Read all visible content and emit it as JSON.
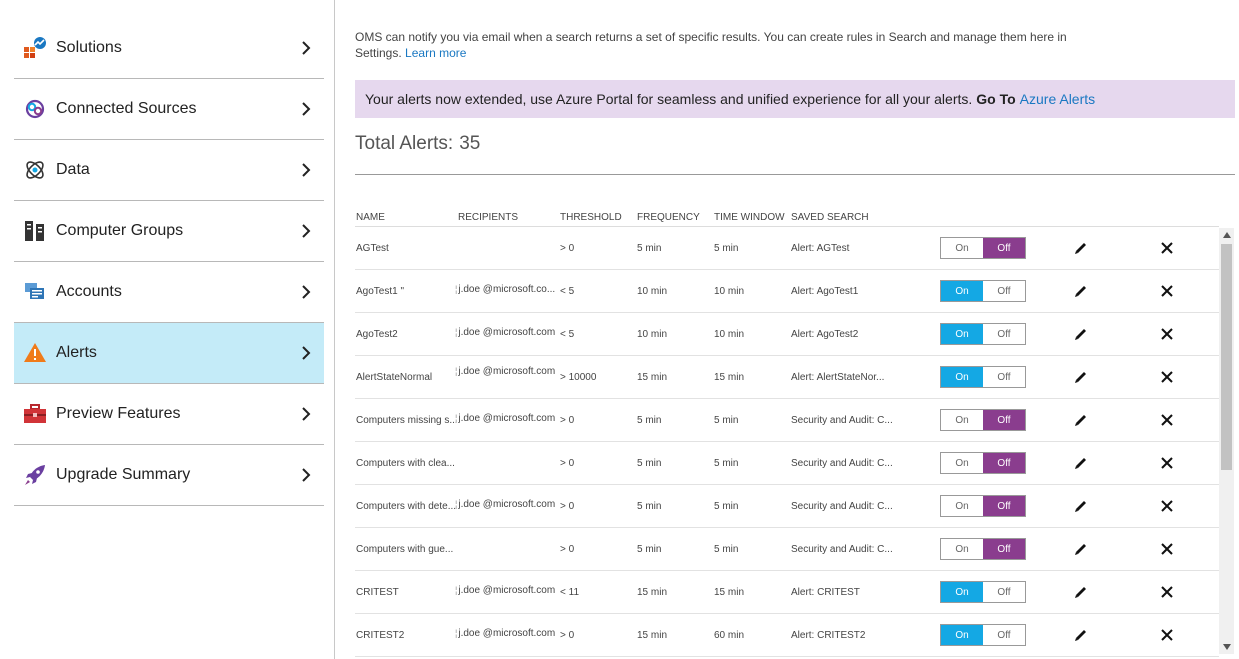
{
  "sidebar": {
    "items": [
      {
        "label": "Solutions",
        "icon": "solutions-icon",
        "active": false
      },
      {
        "label": "Connected Sources",
        "icon": "connected-sources-icon",
        "active": false
      },
      {
        "label": "Data",
        "icon": "data-icon",
        "active": false
      },
      {
        "label": "Computer Groups",
        "icon": "computer-groups-icon",
        "active": false
      },
      {
        "label": "Accounts",
        "icon": "accounts-icon",
        "active": false
      },
      {
        "label": "Alerts",
        "icon": "alert-warning-icon",
        "active": true
      },
      {
        "label": "Preview Features",
        "icon": "toolbox-icon",
        "active": false
      },
      {
        "label": "Upgrade Summary",
        "icon": "rocket-icon",
        "active": false
      }
    ]
  },
  "main": {
    "info_text": "OMS can notify you via email when a search returns a set of specific results. You can create rules in Search and manage them here in Settings.",
    "learn_more": "Learn more",
    "banner_text": "Your alerts now extended, use Azure Portal for seamless and unified experience for all your alerts.",
    "banner_goto": "Go To",
    "banner_link": "Azure Alerts",
    "total_label": "Total Alerts:",
    "total_value": "35"
  },
  "table": {
    "headers": {
      "name": "NAME",
      "recipients": "RECIPIENTS",
      "threshold": "THRESHOLD",
      "frequency": "FREQUENCY",
      "time_window": "TIME WINDOW",
      "saved_search": "SAVED SEARCH"
    },
    "toggle_on_label": "On",
    "toggle_off_label": "Off",
    "rows": [
      {
        "name": "AGTest",
        "recipients": "",
        "threshold": "> 0",
        "frequency": "5 min",
        "time_window": "5 min",
        "saved_search": "Alert: AGTest",
        "state": "off"
      },
      {
        "name": "AgoTest1 \"",
        "recipients": "j.doe @microsoft.co...",
        "threshold": "< 5",
        "frequency": "10 min",
        "time_window": "10 min",
        "saved_search": "Alert: AgoTest1",
        "state": "on"
      },
      {
        "name": "AgoTest2",
        "recipients": "j.doe @microsoft.com",
        "threshold": "< 5",
        "frequency": "10 min",
        "time_window": "10 min",
        "saved_search": "Alert: AgoTest2",
        "state": "on"
      },
      {
        "name": "AlertStateNormal",
        "recipients": "j.doe @microsoft.com",
        "threshold": "> 10000",
        "frequency": "15 min",
        "time_window": "15 min",
        "saved_search": "Alert: AlertStateNor...",
        "state": "on"
      },
      {
        "name": "Computers missing s...",
        "recipients": "j.doe @microsoft.com",
        "threshold": "> 0",
        "frequency": "5 min",
        "time_window": "5 min",
        "saved_search": "Security and Audit: C...",
        "state": "off"
      },
      {
        "name": "Computers with clea...",
        "recipients": "",
        "threshold": "> 0",
        "frequency": "5 min",
        "time_window": "5 min",
        "saved_search": "Security and Audit: C...",
        "state": "off"
      },
      {
        "name": "Computers with dete...",
        "recipients": "j.doe @microsoft.com",
        "threshold": "> 0",
        "frequency": "5 min",
        "time_window": "5 min",
        "saved_search": "Security and Audit: C...",
        "state": "off"
      },
      {
        "name": "Computers with gue...",
        "recipients": "",
        "threshold": "> 0",
        "frequency": "5 min",
        "time_window": "5 min",
        "saved_search": "Security and Audit: C...",
        "state": "off"
      },
      {
        "name": "CRITEST",
        "recipients": "j.doe @microsoft.com",
        "threshold": "< 11",
        "frequency": "15 min",
        "time_window": "15 min",
        "saved_search": "Alert: CRITEST",
        "state": "on"
      },
      {
        "name": "CRITEST2",
        "recipients": "j.doe @microsoft.com",
        "threshold": "> 0",
        "frequency": "15 min",
        "time_window": "60 min",
        "saved_search": "Alert: CRITEST2",
        "state": "on"
      }
    ]
  },
  "colors": {
    "active_nav": "#c4ebf8",
    "banner_bg": "#e6d8ee",
    "toggle_on": "#14a8e4",
    "toggle_off": "#8a3d8e",
    "link": "#1a78c2"
  }
}
